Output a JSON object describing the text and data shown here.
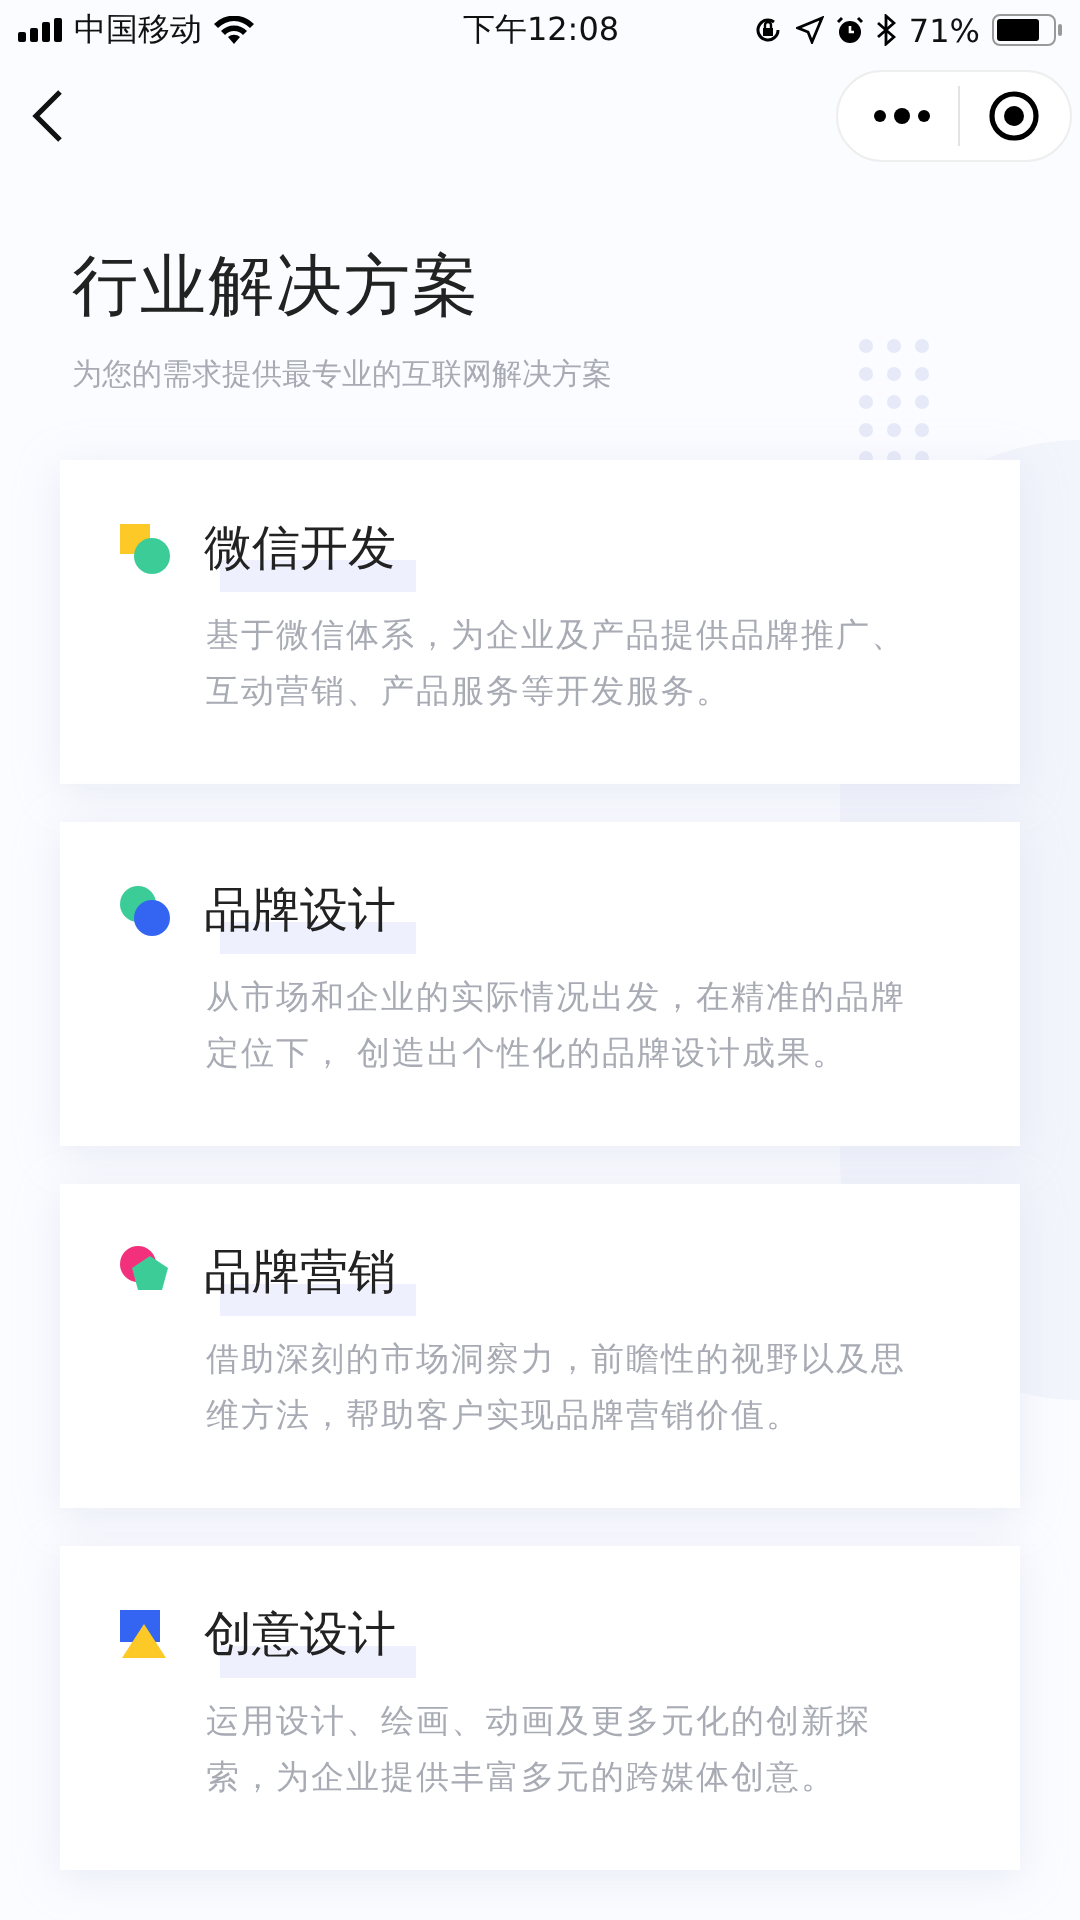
{
  "status_bar": {
    "carrier": "中国移动",
    "time": "下午12:08",
    "battery": "71%"
  },
  "header": {
    "title": "行业解决方案",
    "subtitle": "为您的需求提供最专业的互联网解决方案"
  },
  "services": [
    {
      "kind": "square-circle",
      "title": "微信开发",
      "description": "基于微信体系，为企业及产品提供品牌推广、互动营销、产品服务等开发服务。"
    },
    {
      "kind": "two-circles",
      "title": "品牌设计",
      "description": "从市场和企业的实际情况出发，在精准的品牌定位下， 创造出个性化的品牌设计成果。"
    },
    {
      "kind": "circle-pentagon",
      "title": "品牌营销",
      "description": "借助深刻的市场洞察力，前瞻性的视野以及思维方法，帮助客户实现品牌营销价值。"
    },
    {
      "kind": "square-triangle",
      "title": "创意设计",
      "description": "运用设计、绘画、动画及更多元化的创新探索，为企业提供丰富多元的跨媒体创意。"
    }
  ]
}
